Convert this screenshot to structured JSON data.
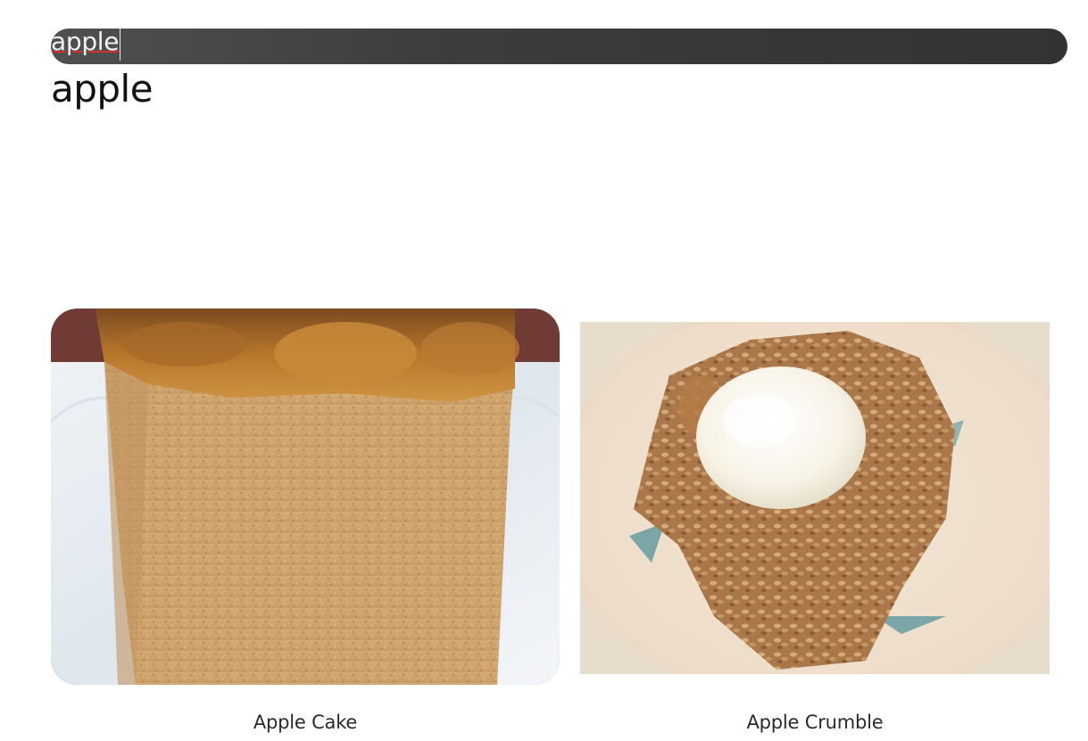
{
  "search": {
    "value": "apple"
  },
  "results_heading": "apple",
  "recipes": [
    {
      "title": "Apple Cake",
      "image_icon": "apple-cake-photo"
    },
    {
      "title": "Apple Crumble",
      "image_icon": "apple-crumble-photo"
    }
  ],
  "colors": {
    "search_bar": "#3c3c3c",
    "search_text": "#f2f2f2",
    "spellcheck_underline": "#d32f2f",
    "heading_text": "#111111",
    "caption_text": "#2a2a2a"
  }
}
